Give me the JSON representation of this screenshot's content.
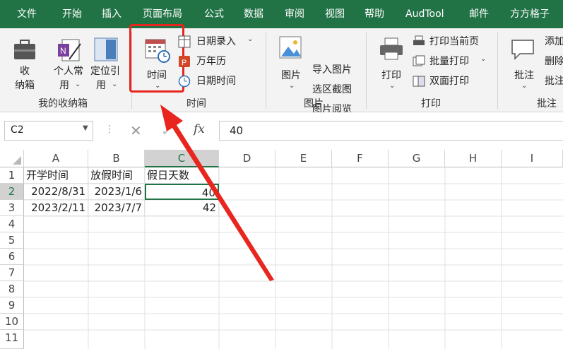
{
  "tabs": [
    "文件",
    "开始",
    "插入",
    "页面布局",
    "公式",
    "数据",
    "审阅",
    "视图",
    "帮助",
    "AudTool",
    "邮件",
    "方方格子"
  ],
  "ribbon": {
    "box": {
      "label1": "收",
      "label2": "纳箱",
      "group": "我的收纳箱"
    },
    "personal": {
      "label1": "个人常",
      "label2": "用"
    },
    "locate": {
      "label1": "定位引",
      "label2": "用"
    },
    "time_group": {
      "big_label": "时间",
      "date_entry": "日期录入",
      "calendar": "万年历",
      "date_time": "日期时间",
      "group": "时间"
    },
    "image_group": {
      "big_label": "图片",
      "import": "导入图片",
      "region": "选区截图",
      "browse": "图片阅览",
      "group": "图片"
    },
    "print_group": {
      "big_label": "打印",
      "print_current": "打印当前页",
      "batch": "批量打印",
      "duplex": "双面打印",
      "group": "打印"
    },
    "comment_group": {
      "big_label": "批注",
      "add": "添加",
      "delete": "删除",
      "more": "批注",
      "group": "批注"
    }
  },
  "formula_bar": {
    "name_box": "C2",
    "fx": "fx",
    "value": "40"
  },
  "columns": [
    "A",
    "B",
    "C",
    "D",
    "E",
    "F",
    "G",
    "H",
    "I"
  ],
  "rows": [
    "1",
    "2",
    "3",
    "4",
    "5",
    "6",
    "7",
    "8",
    "9",
    "10",
    "11"
  ],
  "cells": {
    "A1": "开学时间",
    "B1": "放假时间",
    "C1": "假日天数",
    "A2": "2022/8/31",
    "B2": "2023/1/6",
    "C2": "40",
    "A3": "2023/2/11",
    "B3": "2023/7/7",
    "C3": "42"
  },
  "colors": {
    "tab_green": "#217346",
    "highlight_red": "#e8261f",
    "arrow_red": "#e8261f"
  }
}
